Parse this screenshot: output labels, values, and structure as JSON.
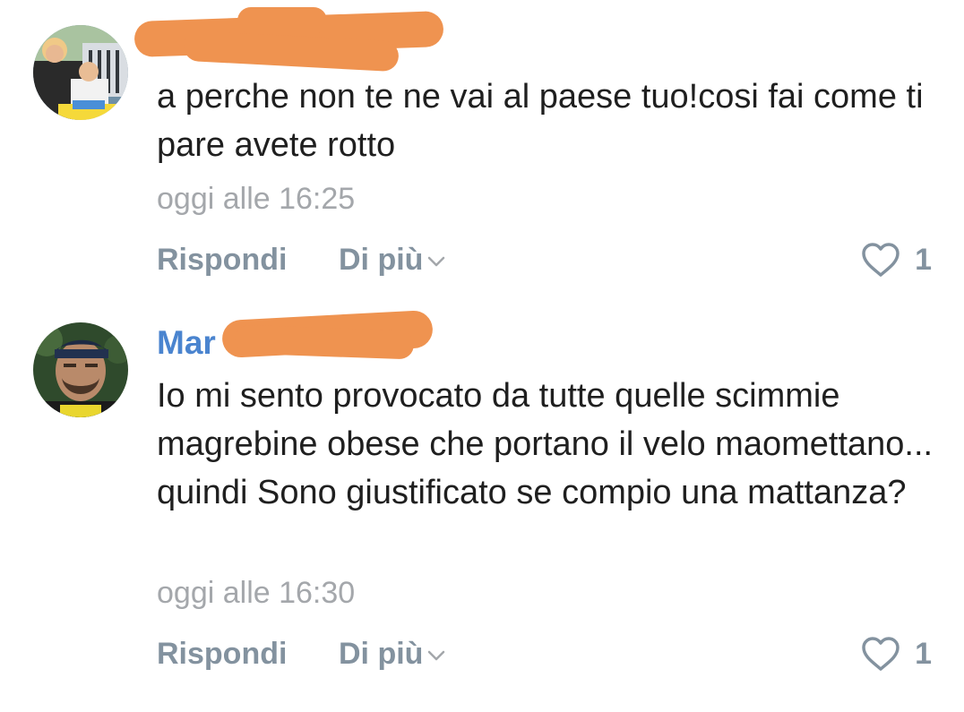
{
  "colors": {
    "author_link": "#4a84cf",
    "redaction": "#ef9350",
    "text": "#1f1f1f",
    "meta": "#a4a7ab",
    "action": "#83929f"
  },
  "comments": [
    {
      "author": "",
      "text": "a perche non te ne vai al paese tuo!cosi fai come ti pare avete rotto",
      "timestamp": "oggi alle 16:25",
      "reply_label": "Rispondi",
      "more_label": "Di più",
      "likes": "1",
      "like_icon": "heart-outline-icon",
      "more_icon": "chevron-down-icon"
    },
    {
      "author": "Mar",
      "text": "Io mi sento provocato da tutte quelle scimmie magrebine obese che portano il velo maomettano... quindi Sono giustificato se compio una mattanza?",
      "timestamp": "oggi alle 16:30",
      "reply_label": "Rispondi",
      "more_label": "Di più",
      "likes": "1",
      "like_icon": "heart-outline-icon",
      "more_icon": "chevron-down-icon"
    }
  ]
}
